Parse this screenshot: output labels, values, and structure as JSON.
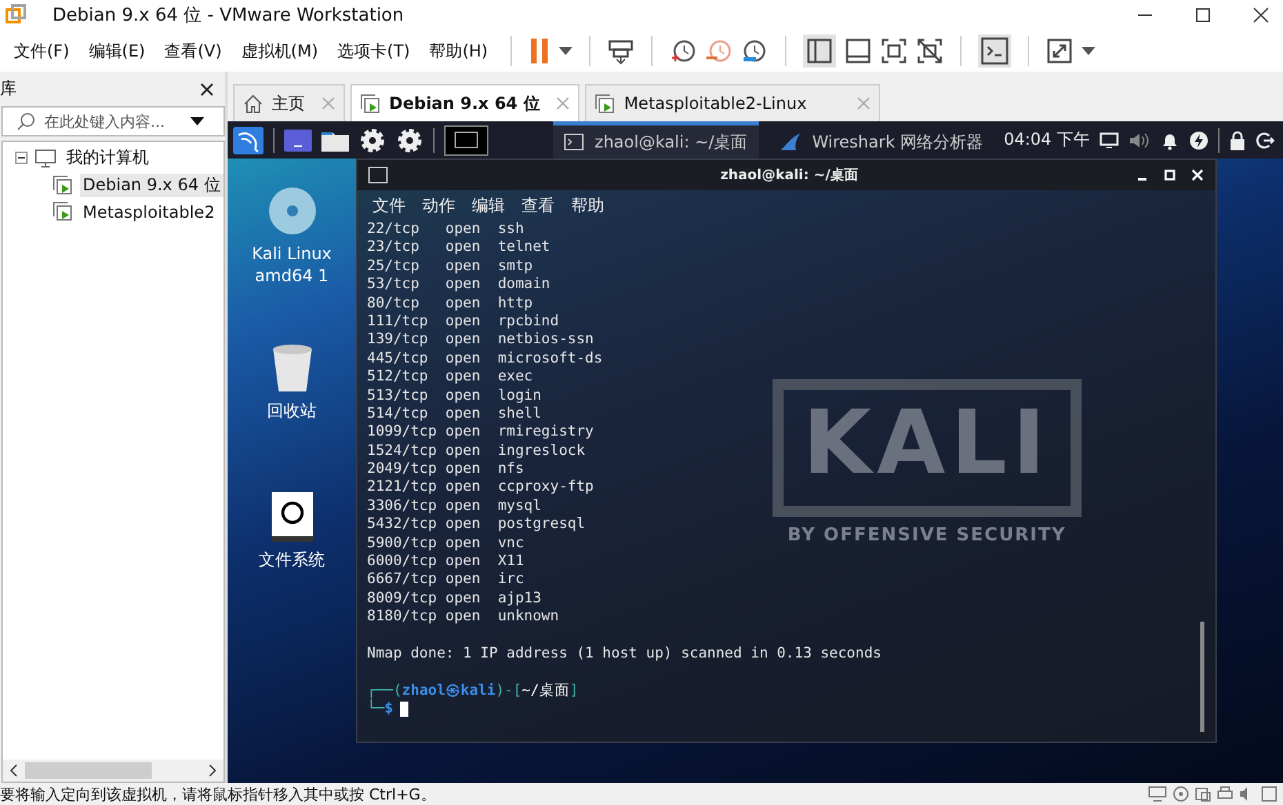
{
  "window": {
    "title": "Debian 9.x 64 位 - VMware Workstation"
  },
  "menu": [
    "文件(F)",
    "编辑(E)",
    "查看(V)",
    "虚拟机(M)",
    "选项卡(T)",
    "帮助(H)"
  ],
  "library": {
    "title": "库",
    "search": {
      "placeholder": "在此处键入内容..."
    },
    "tree": [
      {
        "label": "我的计算机",
        "expanded": true,
        "children": [
          {
            "label": "Debian 9.x 64 位",
            "selected": true
          },
          {
            "label": "Metasploitable2",
            "selected": false
          }
        ]
      }
    ]
  },
  "tabs": [
    {
      "label": "主页",
      "kind": "home",
      "selected": false
    },
    {
      "label": "Debian 9.x 64 位",
      "kind": "vm",
      "selected": true
    },
    {
      "label": "Metasploitable2-Linux",
      "kind": "vm",
      "selected": false
    }
  ],
  "kali_panel": {
    "tasks": [
      {
        "label": "zhaol@kali: ~/桌面",
        "kind": "terminal",
        "selected": true
      },
      {
        "label": "Wireshark 网络分析器",
        "kind": "wireshark",
        "selected": false
      }
    ],
    "clock": "04:04 下午"
  },
  "desktop_icons": [
    {
      "label": "Kali Linux amd64 1",
      "kind": "disc"
    },
    {
      "label": "回收站",
      "kind": "trash"
    },
    {
      "label": "文件系统",
      "kind": "drive"
    }
  ],
  "wallpaper": {
    "logo": "KALI",
    "tagline": "BY OFFENSIVE SECURITY"
  },
  "terminal": {
    "title": "zhaol@kali: ~/桌面",
    "menu": [
      "文件",
      "动作",
      "编辑",
      "查看",
      "帮助"
    ],
    "lines": [
      "22/tcp   open  ssh",
      "23/tcp   open  telnet",
      "25/tcp   open  smtp",
      "53/tcp   open  domain",
      "80/tcp   open  http",
      "111/tcp  open  rpcbind",
      "139/tcp  open  netbios-ssn",
      "445/tcp  open  microsoft-ds",
      "512/tcp  open  exec",
      "513/tcp  open  login",
      "514/tcp  open  shell",
      "1099/tcp open  rmiregistry",
      "1524/tcp open  ingreslock",
      "2049/tcp open  nfs",
      "2121/tcp open  ccproxy-ftp",
      "3306/tcp open  mysql",
      "5432/tcp open  postgresql",
      "5900/tcp open  vnc",
      "6000/tcp open  X11",
      "6667/tcp open  irc",
      "8009/tcp open  ajp13",
      "8180/tcp open  unknown"
    ],
    "summary": "Nmap done: 1 IP address (1 host up) scanned in 0.13 seconds",
    "prompt": [
      [
        {
          "text": "┌──(",
          "kind": "frame"
        },
        {
          "text": "zhaol㉿kali",
          "kind": "user"
        },
        {
          "text": ")-[",
          "kind": "frame"
        },
        {
          "text": "~/桌面",
          "kind": "path"
        },
        {
          "text": "]",
          "kind": "frame"
        }
      ],
      [
        {
          "text": "└─",
          "kind": "frame"
        },
        {
          "text": "$",
          "kind": "user"
        }
      ]
    ]
  },
  "status_bar": "要将输入定向到该虚拟机，请将鼠标指针移入其中或按 Ctrl+G。"
}
